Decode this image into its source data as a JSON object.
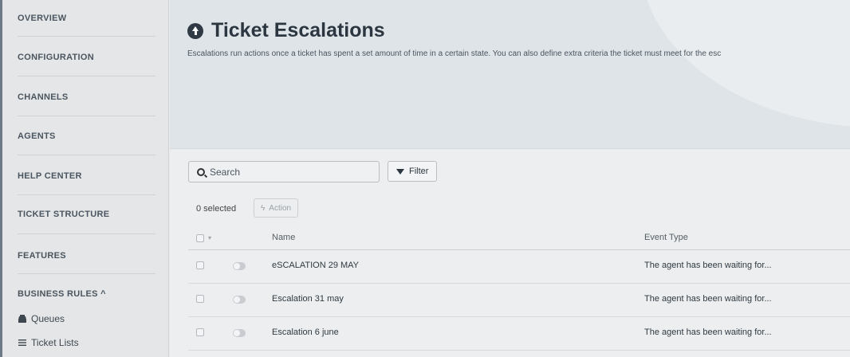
{
  "sidebar": {
    "items": [
      {
        "label": "OVERVIEW"
      },
      {
        "label": "CONFIGURATION"
      },
      {
        "label": "CHANNELS"
      },
      {
        "label": "AGENTS"
      },
      {
        "label": "HELP CENTER"
      },
      {
        "label": "TICKET STRUCTURE"
      },
      {
        "label": "FEATURES"
      },
      {
        "label": "BUSINESS RULES ^"
      }
    ],
    "subitems": [
      {
        "label": "Queues",
        "icon": "inbox-icon"
      },
      {
        "label": "Ticket Lists",
        "icon": "list-icon"
      }
    ]
  },
  "header": {
    "title": "Ticket Escalations",
    "description": "Escalations run actions once a ticket has spent a set amount of time in a certain state. You can also define extra criteria the ticket must meet for the esc"
  },
  "toolbar": {
    "search_placeholder": "Search",
    "filter_label": "Filter",
    "selected_text": "0 selected",
    "action_label": "Action"
  },
  "table": {
    "columns": {
      "name": "Name",
      "event_type": "Event Type"
    },
    "rows": [
      {
        "name": "eSCALATION 29 MAY",
        "event_type": "The agent has been waiting for..."
      },
      {
        "name": "Escalation 31 may",
        "event_type": "The agent has been waiting for..."
      },
      {
        "name": "Escalation 6 june",
        "event_type": "The agent has been waiting for..."
      }
    ]
  },
  "colors": {
    "sidebar_bg": "#e4e6e7",
    "header_bg": "#dfe4e8",
    "text_dark": "#2b3640"
  }
}
